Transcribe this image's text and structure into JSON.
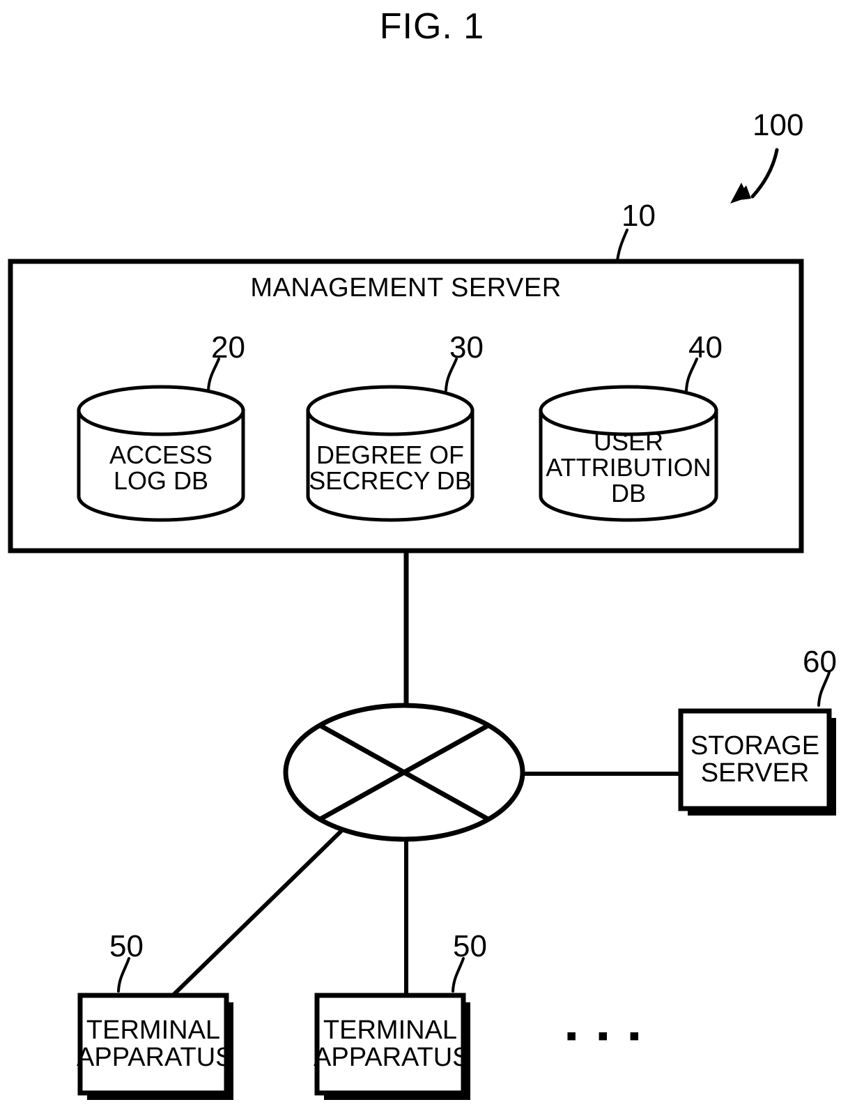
{
  "figure": {
    "title": "FIG. 1",
    "system_ref": "100"
  },
  "management_server": {
    "title": "MANAGEMENT SERVER",
    "ref": "10",
    "databases": [
      {
        "label": "ACCESS\nLOG DB",
        "ref": "20"
      },
      {
        "label": "DEGREE OF\nSECRECY DB",
        "ref": "30"
      },
      {
        "label": "USER\nATTRIBUTION\nDB",
        "ref": "40"
      }
    ]
  },
  "network": {
    "icon": "network-cloud-ellipse-with-cross"
  },
  "storage_server": {
    "label": "STORAGE\nSERVER",
    "ref": "60"
  },
  "terminals": [
    {
      "label": "TERMINAL\nAPPARATUS",
      "ref": "50"
    },
    {
      "label": "TERMINAL\nAPPARATUS",
      "ref": "50"
    }
  ],
  "ellipsis": {
    "label": "▪ ▪ ▪",
    "meaning": "more-terminal-apparatuses"
  },
  "colors": {
    "stroke": "#000000",
    "background": "#ffffff"
  }
}
